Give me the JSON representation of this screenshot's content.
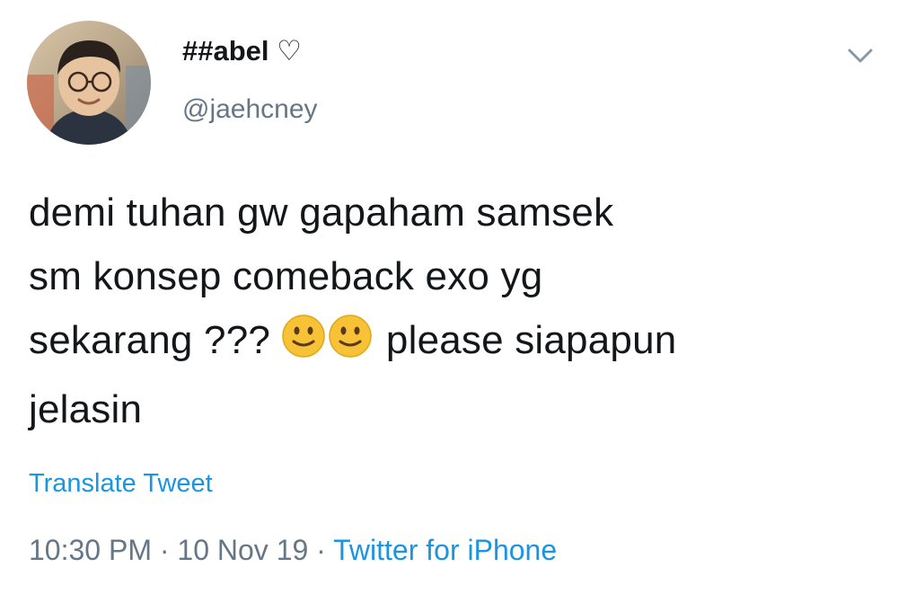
{
  "user": {
    "display_name": "##abel ♡",
    "handle": "@jaehcney"
  },
  "tweet": {
    "lines": [
      "demi tuhan gw gapaham samsek",
      "sm konsep comeback exo yg",
      "sekarang ???",
      "please siapapun",
      "jelasin"
    ],
    "emojis": [
      "slightly-smiling-face",
      "slightly-smiling-face"
    ],
    "translate_label": "Translate Tweet"
  },
  "meta": {
    "time": "10:30 PM",
    "separator": "·",
    "date": "10 Nov 19",
    "source": "Twitter for iPhone"
  },
  "colors": {
    "link": "#1b95e0",
    "secondary_text": "#657786",
    "primary_text": "#14171a",
    "emoji_fill": "#f7c236"
  }
}
